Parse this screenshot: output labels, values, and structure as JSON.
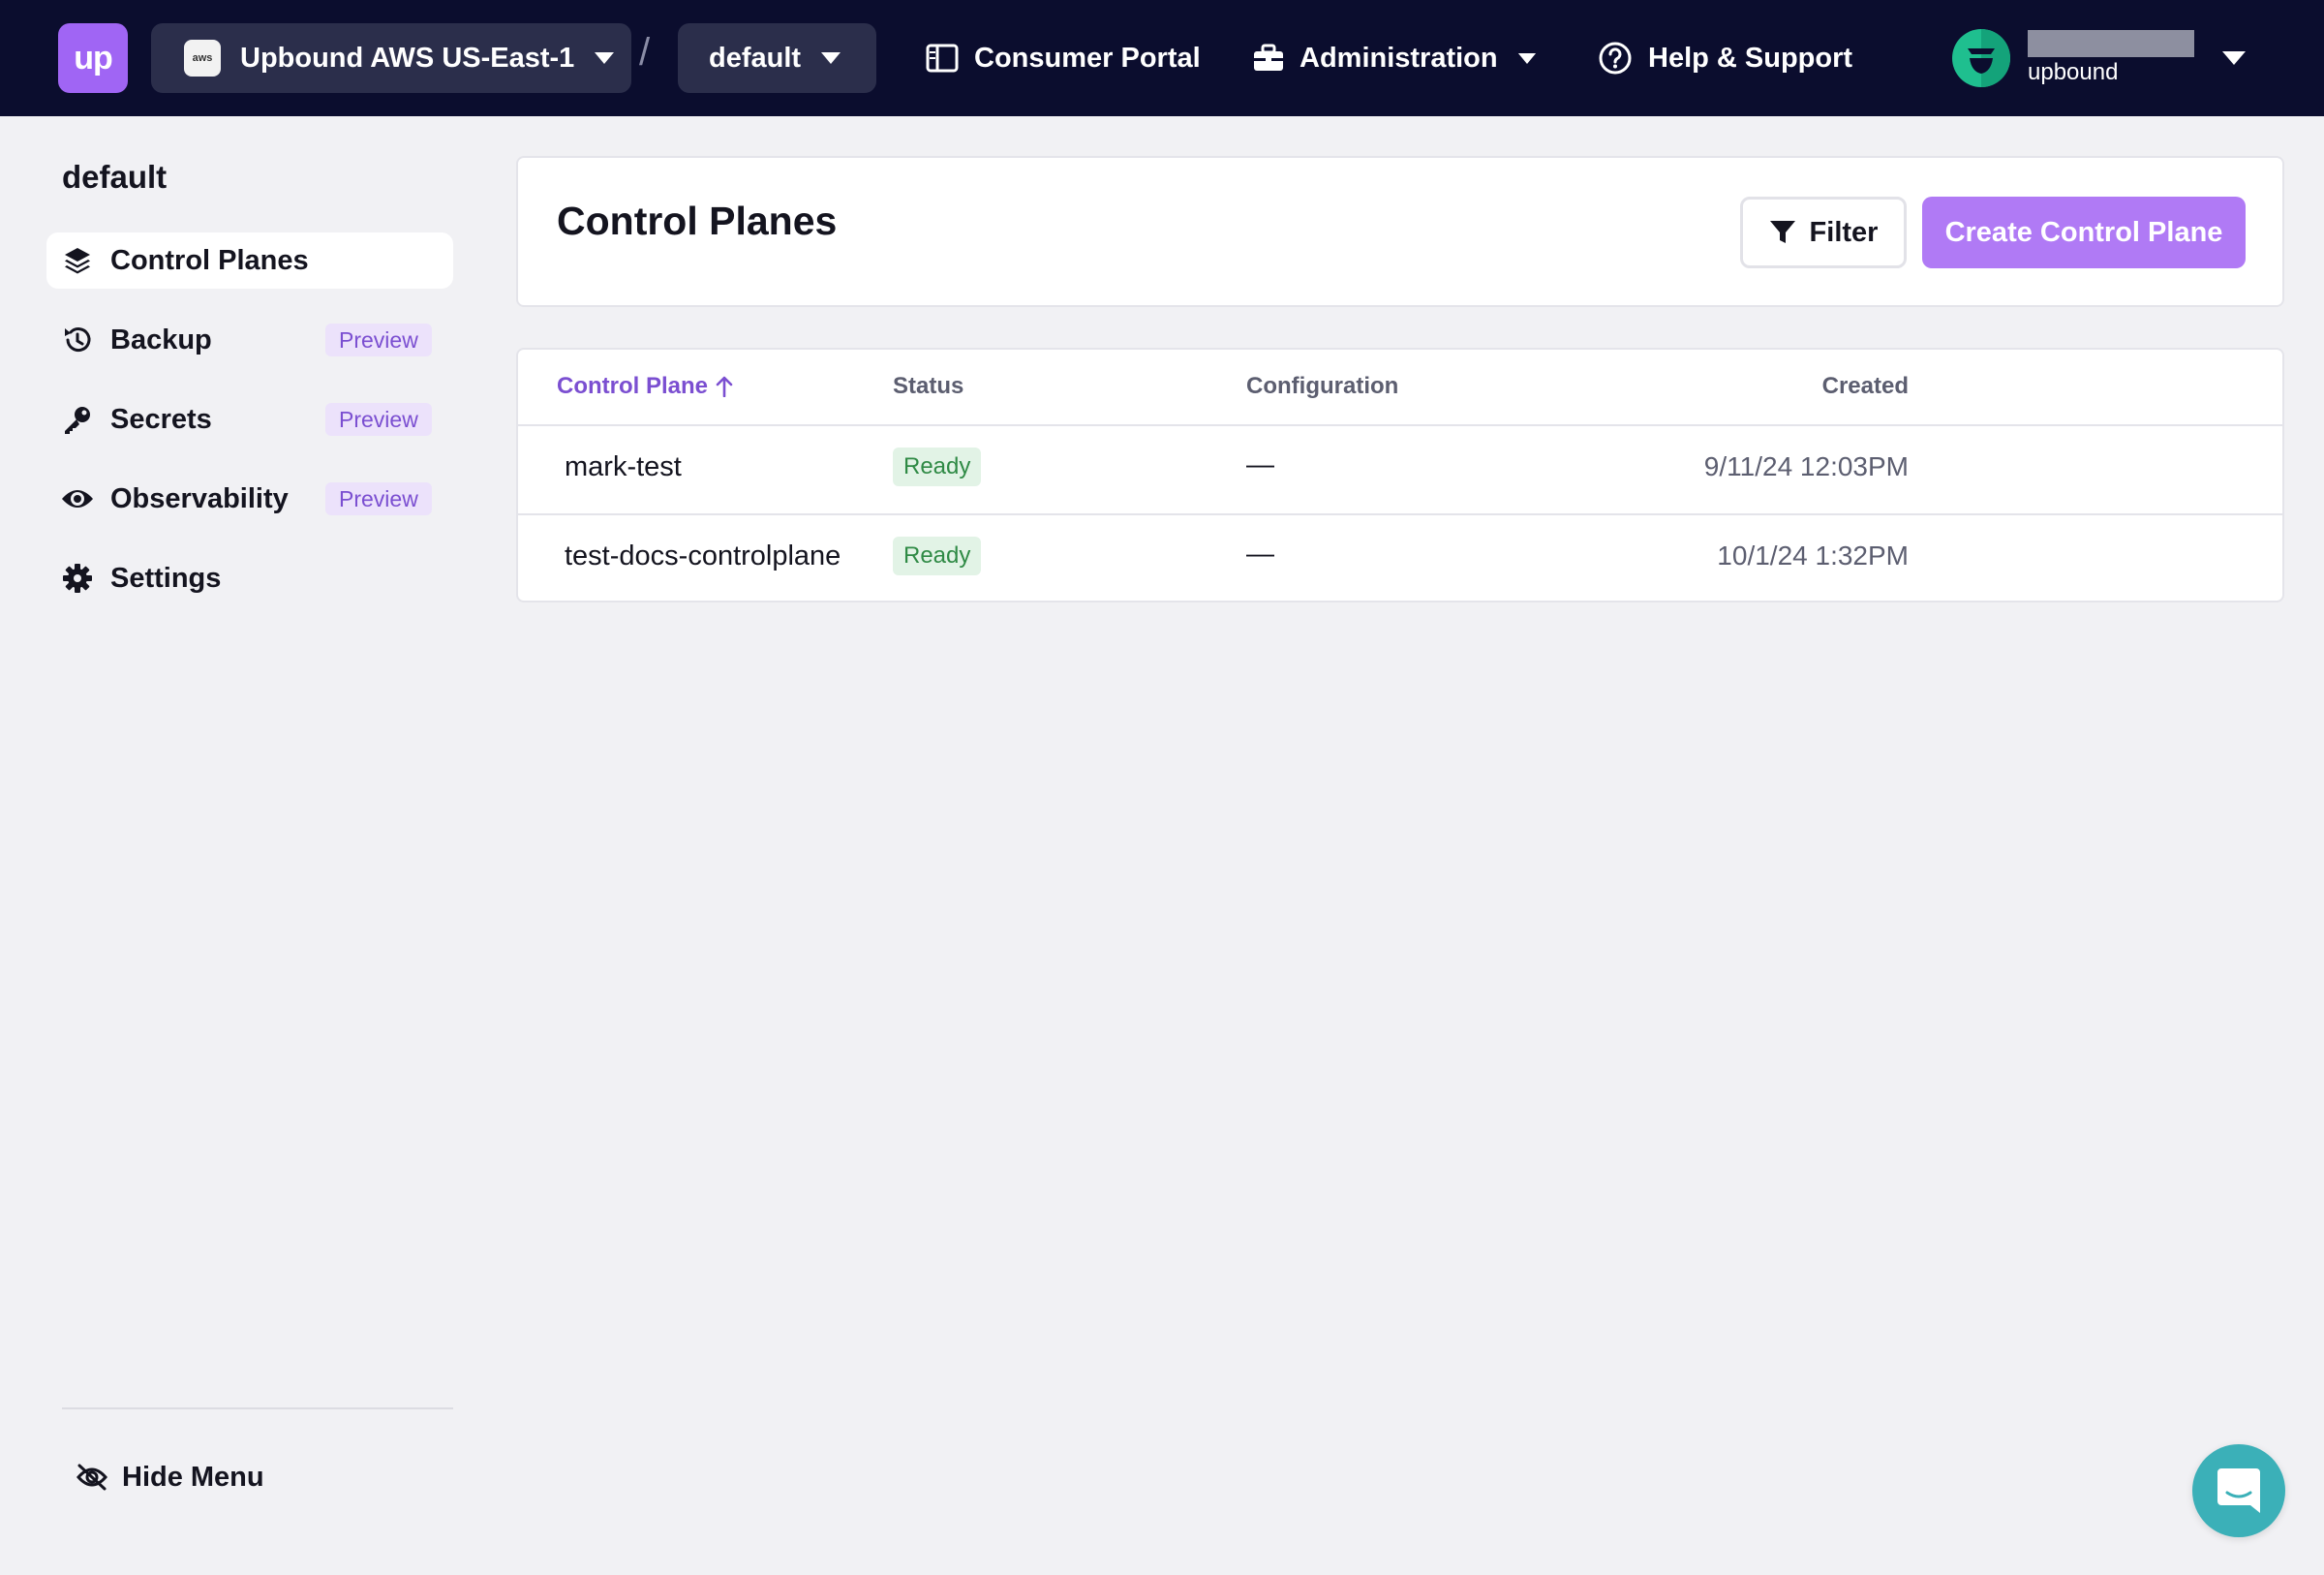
{
  "topbar": {
    "logo_text": "up",
    "account": {
      "label": "Upbound AWS US-East-1",
      "badge_text": "aws"
    },
    "separator": "/",
    "space": {
      "label": "default"
    },
    "nav": {
      "consumer_portal": "Consumer Portal",
      "administration": "Administration",
      "help_support": "Help & Support"
    },
    "user": {
      "org": "upbound"
    }
  },
  "sidebar": {
    "title": "default",
    "items": [
      {
        "label": "Control Planes",
        "icon": "layers-icon",
        "active": true
      },
      {
        "label": "Backup",
        "icon": "history-icon",
        "badge": "Preview"
      },
      {
        "label": "Secrets",
        "icon": "key-icon",
        "badge": "Preview"
      },
      {
        "label": "Observability",
        "icon": "eye-icon",
        "badge": "Preview"
      },
      {
        "label": "Settings",
        "icon": "gear-icon"
      }
    ],
    "hide_menu": "Hide Menu"
  },
  "main": {
    "title": "Control Planes",
    "filter_label": "Filter",
    "create_label": "Create Control Plane",
    "table": {
      "columns": [
        "Control Plane",
        "Status",
        "Configuration",
        "Created"
      ],
      "sort_column": "Control Plane",
      "sort_direction": "ascending",
      "rows": [
        {
          "name": "mark-test",
          "status": "Ready",
          "configuration": "—",
          "created": "9/11/24 12:03PM"
        },
        {
          "name": "test-docs-controlplane",
          "status": "Ready",
          "configuration": "—",
          "created": "10/1/24 1:32PM"
        }
      ]
    }
  },
  "colors": {
    "topbar_bg": "#0b0d2e",
    "brand_purple": "#a065f4",
    "create_button": "#b07af5",
    "status_ready_bg": "#e2f3e6",
    "status_ready_text": "#2f8a45",
    "chat_bubble": "#3bb0b8"
  }
}
